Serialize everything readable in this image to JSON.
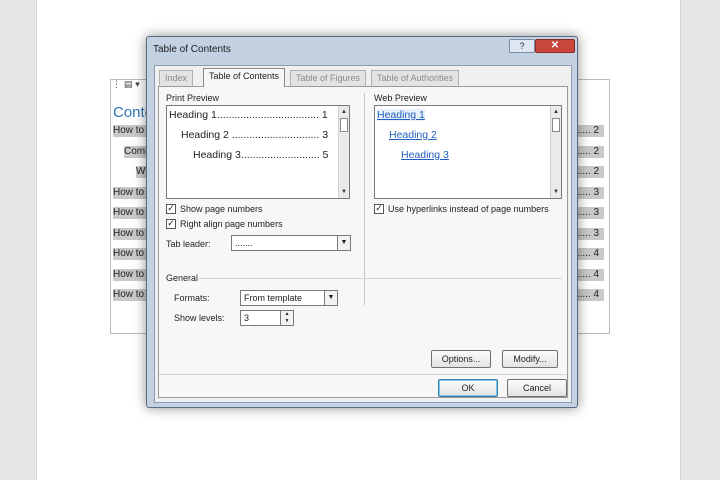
{
  "document": {
    "toolbar_icon": "document-icon",
    "contents_title": "Conte",
    "entries": [
      {
        "text": "How to",
        "page": "...... 2"
      },
      {
        "text": "Comi",
        "page": "...... 2"
      },
      {
        "text": "W",
        "page": "...... 2"
      },
      {
        "text": "How to",
        "page": "...... 3"
      },
      {
        "text": "How to",
        "page": "...... 3"
      },
      {
        "text": "How to",
        "page": "...... 3"
      },
      {
        "text": "How to",
        "page": "...... 4"
      },
      {
        "text": "How to",
        "page": "...... 4"
      },
      {
        "text": "How to",
        "page": "...... 4"
      }
    ]
  },
  "dialog": {
    "title": "Table of Contents",
    "help_label": "?",
    "close_label": "✕",
    "tabs": [
      {
        "label": "Index",
        "active": false
      },
      {
        "label": "Table of Contents",
        "active": true
      },
      {
        "label": "Table of Figures",
        "active": false
      },
      {
        "label": "Table of Authorities",
        "active": false
      }
    ],
    "print_preview": {
      "label": "Print Preview",
      "rows": [
        {
          "text": "Heading 1................................... 1"
        },
        {
          "text": "Heading 2 .............................. 3"
        },
        {
          "text": "Heading 3........................... 5"
        }
      ]
    },
    "web_preview": {
      "label": "Web Preview",
      "links": [
        "Heading 1",
        "Heading 2",
        "Heading 3"
      ]
    },
    "show_page_numbers": {
      "label": "Show page numbers",
      "checked": true
    },
    "right_align": {
      "label": "Right align page numbers",
      "checked": true
    },
    "tab_leader": {
      "label": "Tab leader:",
      "value": "......."
    },
    "use_hyperlinks": {
      "label": "Use hyperlinks instead of page numbers",
      "checked": true
    },
    "general": {
      "label": "General",
      "formats_label": "Formats:",
      "formats_value": "From template",
      "levels_label": "Show levels:",
      "levels_value": "3"
    },
    "options_button": "Options...",
    "modify_button": "Modify...",
    "ok_button": "OK",
    "cancel_button": "Cancel"
  },
  "colors": {
    "link": "#1f5fbf",
    "close": "#c9463d",
    "title_frame": "#c3d1e3"
  }
}
